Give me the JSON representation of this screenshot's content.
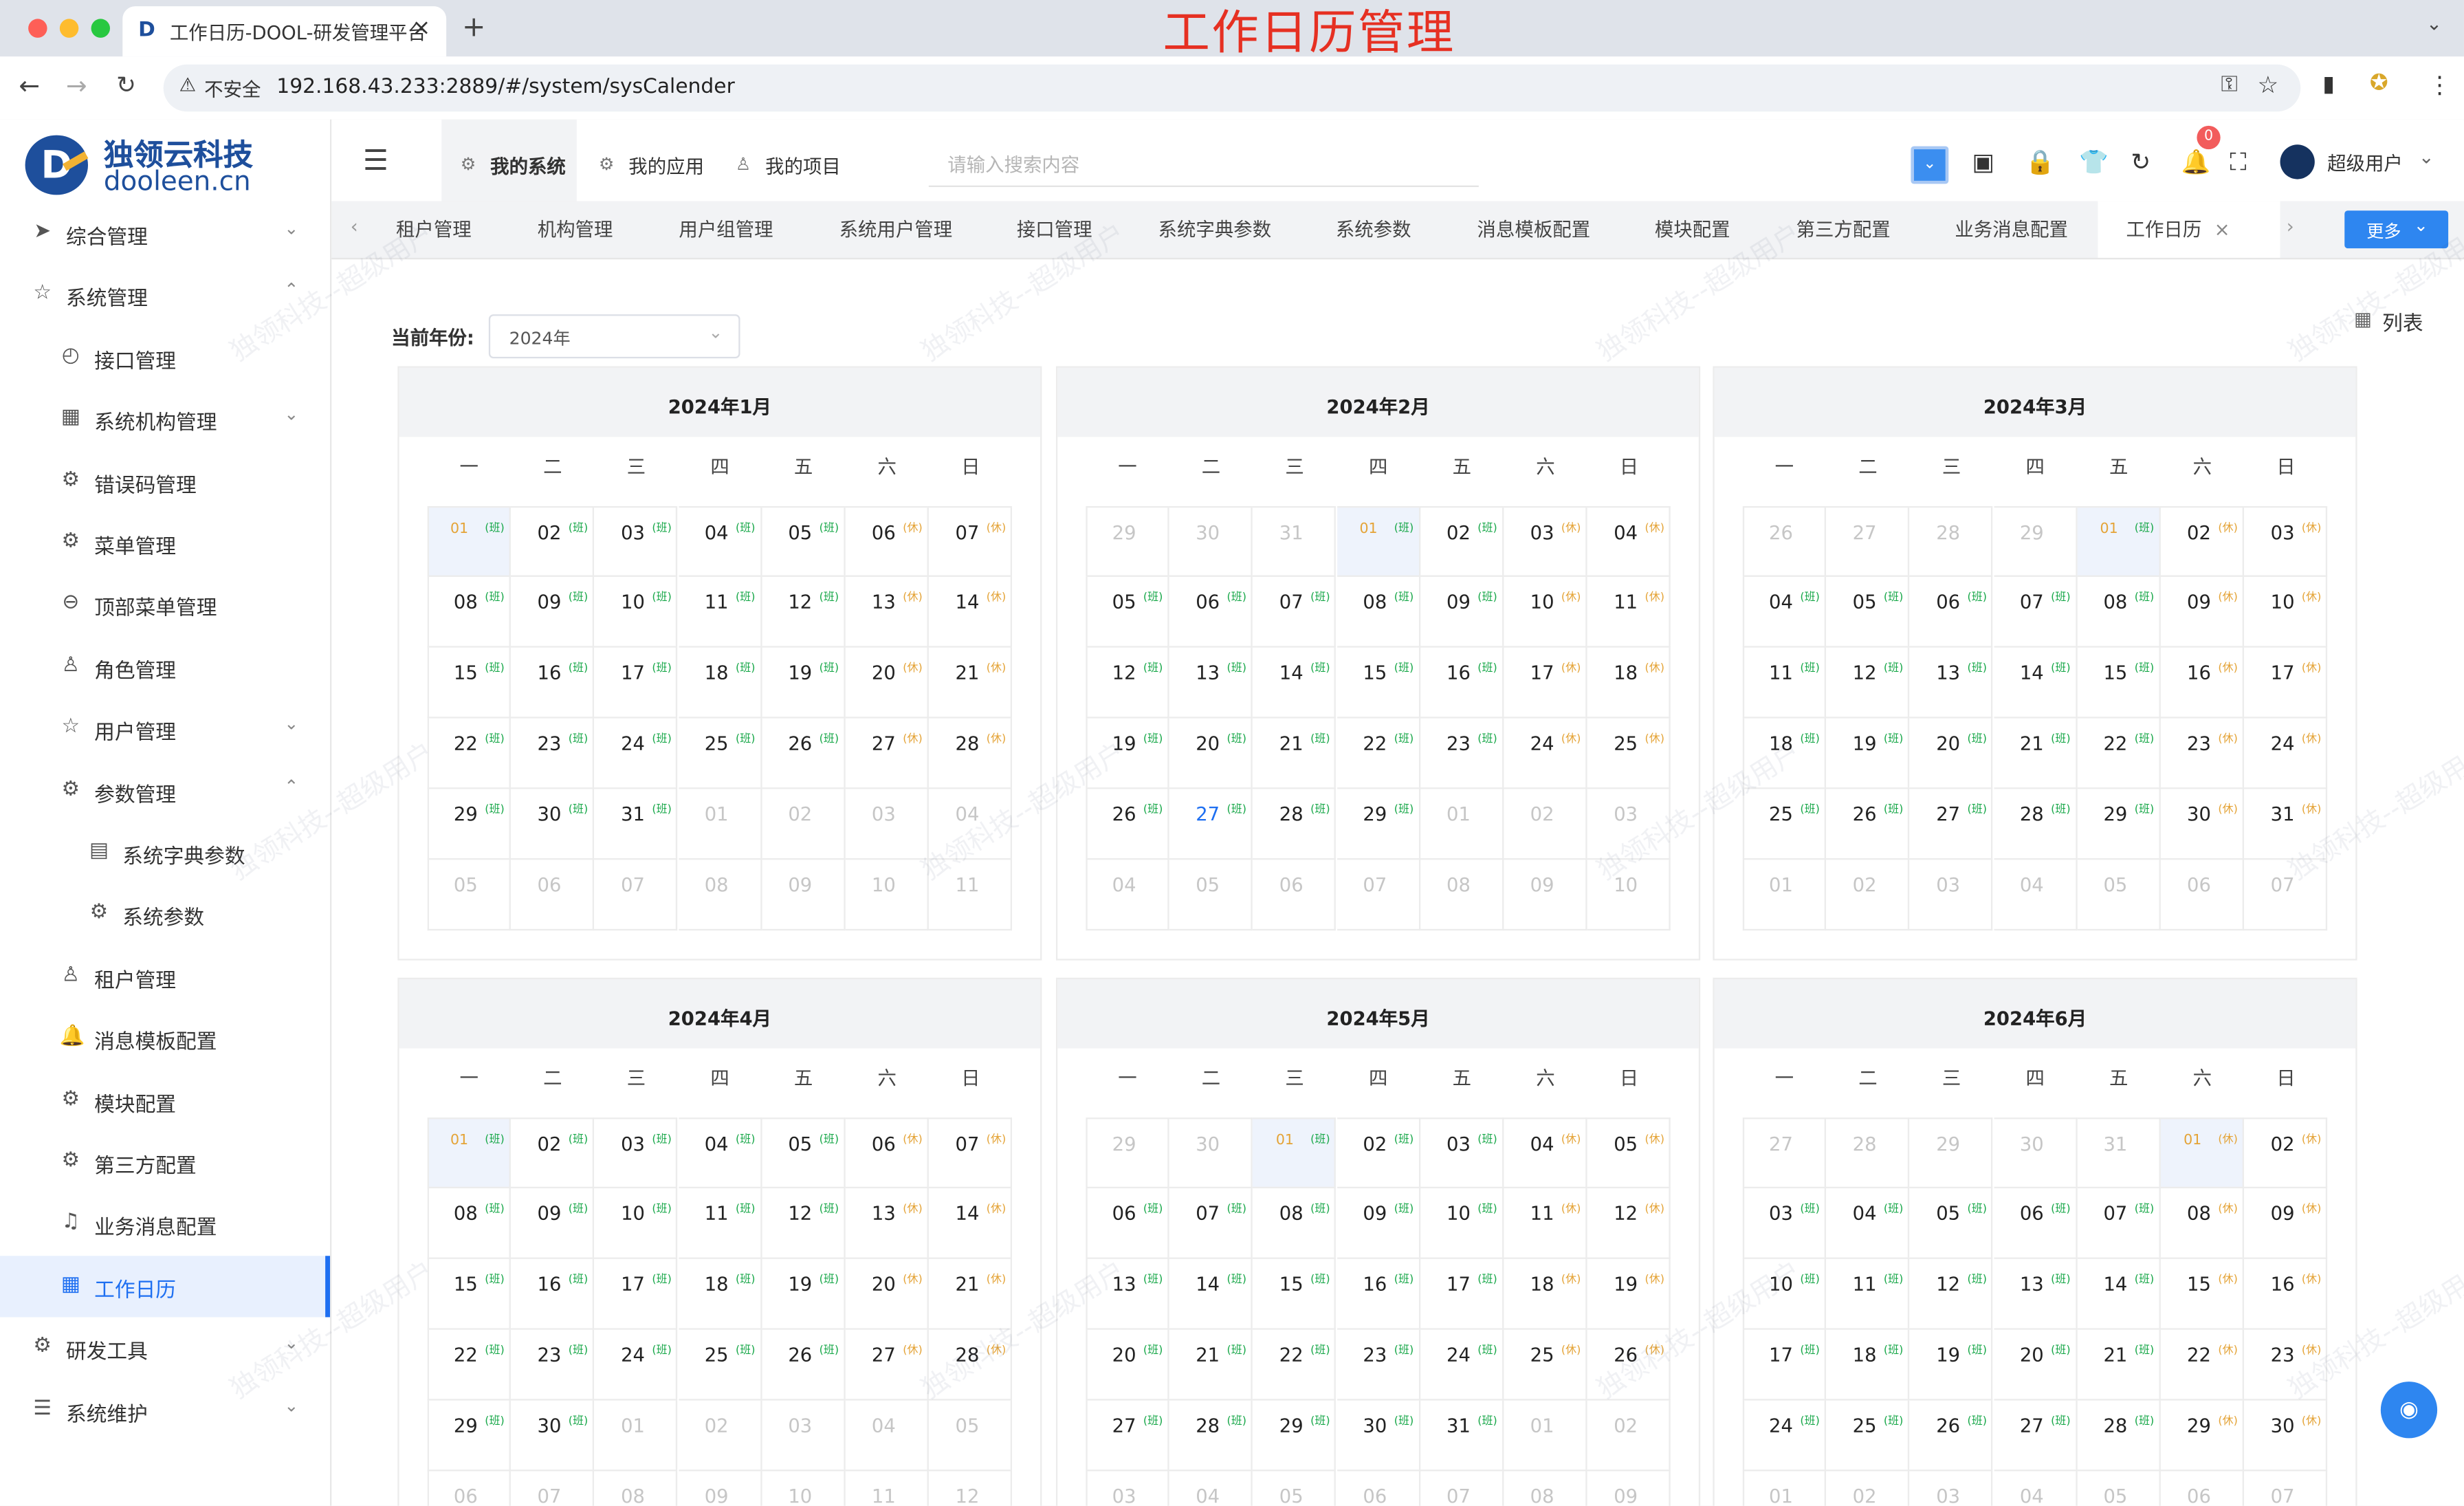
{
  "browser": {
    "tab_title": "工作日历-DOOL-研发管理平台",
    "security_label": "不安全",
    "url": "192.168.43.233:2889/#/system/sysCalender"
  },
  "annotation": "工作日历管理",
  "brand": {
    "name": "独领云科技",
    "domain": "dooleen.cn",
    "color": "#1e4f9c",
    "accent": "#f2b233"
  },
  "sidebar": {
    "items": [
      {
        "label": "综合管理",
        "icon": "send-icon",
        "glyph": "➤",
        "level": 0,
        "chevron": "down"
      },
      {
        "label": "系统管理",
        "icon": "star-icon",
        "glyph": "☆",
        "level": 0,
        "chevron": "up"
      },
      {
        "label": "接口管理",
        "icon": "dashboard-icon",
        "glyph": "◴",
        "level": 1,
        "chevron": ""
      },
      {
        "label": "系统机构管理",
        "icon": "grid-icon",
        "glyph": "▦",
        "level": 1,
        "chevron": "down"
      },
      {
        "label": "错误码管理",
        "icon": "gear-icon",
        "glyph": "⚙",
        "level": 1,
        "chevron": ""
      },
      {
        "label": "菜单管理",
        "icon": "settings-icon",
        "glyph": "⚙",
        "level": 1,
        "chevron": ""
      },
      {
        "label": "顶部菜单管理",
        "icon": "zoom-out-icon",
        "glyph": "⊖",
        "level": 1,
        "chevron": ""
      },
      {
        "label": "角色管理",
        "icon": "user-icon",
        "glyph": "♙",
        "level": 1,
        "chevron": ""
      },
      {
        "label": "用户管理",
        "icon": "star-icon",
        "glyph": "☆",
        "level": 1,
        "chevron": "down"
      },
      {
        "label": "参数管理",
        "icon": "settings-icon",
        "glyph": "⚙",
        "level": 1,
        "chevron": "up"
      },
      {
        "label": "系统字典参数",
        "icon": "document-icon",
        "glyph": "▤",
        "level": 2,
        "chevron": ""
      },
      {
        "label": "系统参数",
        "icon": "settings-icon",
        "glyph": "⚙",
        "level": 2,
        "chevron": ""
      },
      {
        "label": "租户管理",
        "icon": "user-icon",
        "glyph": "♙",
        "level": 1,
        "chevron": ""
      },
      {
        "label": "消息模板配置",
        "icon": "bell-icon",
        "glyph": "🔔",
        "level": 1,
        "chevron": ""
      },
      {
        "label": "模块配置",
        "icon": "settings-icon",
        "glyph": "⚙",
        "level": 1,
        "chevron": ""
      },
      {
        "label": "第三方配置",
        "icon": "settings-icon",
        "glyph": "⚙",
        "level": 1,
        "chevron": ""
      },
      {
        "label": "业务消息配置",
        "icon": "bell-icon",
        "glyph": "♫",
        "level": 1,
        "chevron": ""
      },
      {
        "label": "工作日历",
        "icon": "calendar-icon",
        "glyph": "▦",
        "level": 1,
        "chevron": "",
        "active": true
      },
      {
        "label": "研发工具",
        "icon": "settings-icon",
        "glyph": "⚙",
        "level": 0,
        "chevron": "down"
      },
      {
        "label": "系统维护",
        "icon": "sliders-icon",
        "glyph": "☰",
        "level": 0,
        "chevron": "down"
      }
    ]
  },
  "header": {
    "nav": [
      {
        "label": "我的系统",
        "icon": "gear-icon",
        "glyph": "⚙",
        "active": true
      },
      {
        "label": "我的应用",
        "icon": "settings-icon",
        "glyph": "⚙",
        "active": false
      },
      {
        "label": "我的项目",
        "icon": "user-icon",
        "glyph": "♙",
        "active": false
      }
    ],
    "search_placeholder": "请输入搜索内容",
    "notification_count": "0",
    "user_name": "超级用户"
  },
  "page_tabs": [
    "租户管理",
    "机构管理",
    "用户组管理",
    "系统用户管理",
    "接口管理",
    "系统字典参数",
    "系统参数",
    "消息模板配置",
    "模块配置",
    "第三方配置",
    "业务消息配置",
    "工作日历"
  ],
  "more_label": "更多",
  "content": {
    "year_label": "当前年份:",
    "year_value": "2024年",
    "list_label": "列表",
    "weekdays": [
      "一",
      "二",
      "三",
      "四",
      "五",
      "六",
      "日"
    ],
    "work_tag": "(班)",
    "rest_tag": "(休)",
    "watermark": "独领科技--超级用户"
  },
  "months": [
    {
      "title": "2024年1月",
      "start": 0,
      "days": 31,
      "prev": 31,
      "today": 0
    },
    {
      "title": "2024年2月",
      "start": 3,
      "days": 29,
      "prev": 31,
      "today": 27
    },
    {
      "title": "2024年3月",
      "start": 4,
      "days": 31,
      "prev": 29,
      "today": 0
    },
    {
      "title": "2024年4月",
      "start": 0,
      "days": 30,
      "prev": 31,
      "today": 0
    },
    {
      "title": "2024年5月",
      "start": 2,
      "days": 31,
      "prev": 30,
      "today": 0
    },
    {
      "title": "2024年6月",
      "start": 5,
      "days": 30,
      "prev": 31,
      "today": 0
    }
  ]
}
